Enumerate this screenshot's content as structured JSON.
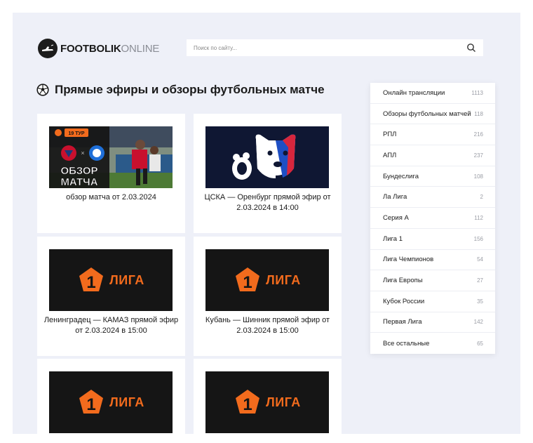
{
  "logo": {
    "bold": "FOOTBOLIK",
    "light": "ONLINE"
  },
  "search": {
    "placeholder": "Поиск по сайту..."
  },
  "page_title": "Прямые эфиры и обзоры футбольных матче",
  "cards": [
    {
      "title": "обзор матча от 2.03.2024",
      "thumb": {
        "tour": "19 ТУР",
        "label_line1": "ОБЗОР",
        "label_line2": "МАТЧА"
      }
    },
    {
      "title": "ЦСКА — Оренбург прямой эфир от 2.03.2024 в 14:00"
    },
    {
      "title": "Ленинградец — КАМАЗ прямой эфир от 2.03.2024 в 15:00",
      "thumb": {
        "num": "1",
        "text": "ЛИГА"
      }
    },
    {
      "title": "Кубань — Шинник прямой эфир от 2.03.2024 в 15:00",
      "thumb": {
        "num": "1",
        "text": "ЛИГА"
      }
    },
    {
      "title": "",
      "thumb": {
        "num": "1",
        "text": "ЛИГА"
      }
    },
    {
      "title": "",
      "thumb": {
        "num": "1",
        "text": "ЛИГА"
      }
    }
  ],
  "sidebar": [
    {
      "label": "Онлайн трансляции",
      "count": "1113"
    },
    {
      "label": "Обзоры футбольных матчей",
      "count": "118"
    },
    {
      "label": "РПЛ",
      "count": "216"
    },
    {
      "label": "АПЛ",
      "count": "237"
    },
    {
      "label": "Бундеслига",
      "count": "108"
    },
    {
      "label": "Ла Лига",
      "count": "2"
    },
    {
      "label": "Серия А",
      "count": "112"
    },
    {
      "label": "Лига 1",
      "count": "156"
    },
    {
      "label": "Лига Чемпионов",
      "count": "54"
    },
    {
      "label": "Лига Европы",
      "count": "27"
    },
    {
      "label": "Кубок России",
      "count": "35"
    },
    {
      "label": "Первая Лига",
      "count": "142"
    },
    {
      "label": "Все остальные",
      "count": "65"
    }
  ],
  "colors": {
    "accent": "#f26b1d",
    "page_bg": "#eef0f8",
    "dark": "#151515"
  }
}
